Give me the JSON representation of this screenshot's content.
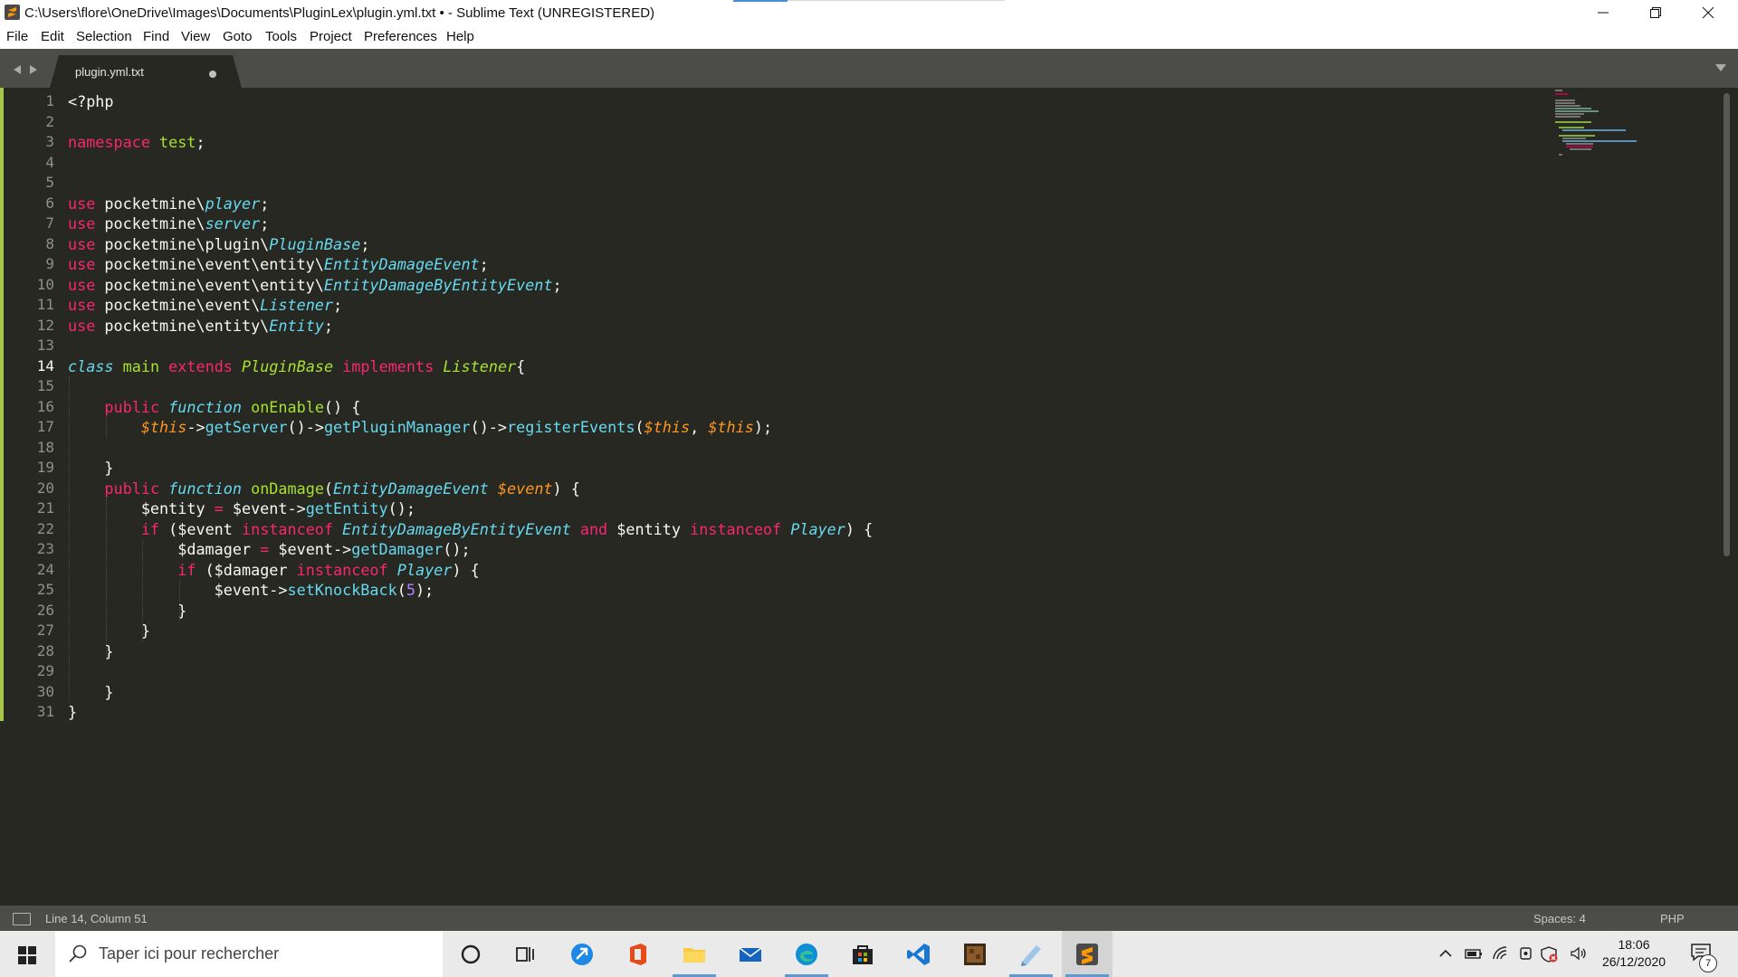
{
  "window": {
    "title": "C:\\Users\\flore\\OneDrive\\Images\\Documents\\PluginLex\\plugin.yml.txt • - Sublime Text (UNREGISTERED)"
  },
  "menu": [
    "File",
    "Edit",
    "Selection",
    "Find",
    "View",
    "Goto",
    "Tools",
    "Project",
    "Preferences",
    "Help"
  ],
  "tab": {
    "label": "plugin.yml.txt",
    "modified": true
  },
  "editor": {
    "active_line": 14,
    "lines": [
      [
        [
          "punc",
          "<?php"
        ]
      ],
      [],
      [
        [
          "k",
          "namespace"
        ],
        [
          "punc",
          " "
        ],
        [
          "cls",
          "test"
        ],
        [
          "punc",
          ";"
        ]
      ],
      [],
      [],
      [
        [
          "k",
          "use"
        ],
        [
          "punc",
          " pocketmine\\"
        ],
        [
          "s",
          "player"
        ],
        [
          "punc",
          ";"
        ]
      ],
      [
        [
          "k",
          "use"
        ],
        [
          "punc",
          " pocketmine\\"
        ],
        [
          "s",
          "server"
        ],
        [
          "punc",
          ";"
        ]
      ],
      [
        [
          "k",
          "use"
        ],
        [
          "punc",
          " pocketmine\\plugin\\"
        ],
        [
          "s",
          "PluginBase"
        ],
        [
          "punc",
          ";"
        ]
      ],
      [
        [
          "k",
          "use"
        ],
        [
          "punc",
          " pocketmine\\event\\entity\\"
        ],
        [
          "s",
          "EntityDamageEvent"
        ],
        [
          "punc",
          ";"
        ]
      ],
      [
        [
          "k",
          "use"
        ],
        [
          "punc",
          " pocketmine\\event\\entity\\"
        ],
        [
          "s",
          "EntityDamageByEntityEvent"
        ],
        [
          "punc",
          ";"
        ]
      ],
      [
        [
          "k",
          "use"
        ],
        [
          "punc",
          " pocketmine\\event\\"
        ],
        [
          "s",
          "Listener"
        ],
        [
          "punc",
          ";"
        ]
      ],
      [
        [
          "k",
          "use"
        ],
        [
          "punc",
          " pocketmine\\entity\\"
        ],
        [
          "s",
          "Entity"
        ],
        [
          "punc",
          ";"
        ]
      ],
      [],
      [
        [
          "s",
          "class"
        ],
        [
          "punc",
          " "
        ],
        [
          "cls",
          "main"
        ],
        [
          "punc",
          " "
        ],
        [
          "k",
          "extends"
        ],
        [
          "punc",
          " "
        ],
        [
          "ci",
          "PluginBase"
        ],
        [
          "punc",
          " "
        ],
        [
          "k",
          "implements"
        ],
        [
          "punc",
          " "
        ],
        [
          "ci",
          "Listener"
        ],
        [
          "punc",
          "{"
        ]
      ],
      [],
      [
        [
          "punc",
          "    "
        ],
        [
          "k",
          "public"
        ],
        [
          "punc",
          " "
        ],
        [
          "s",
          "function"
        ],
        [
          "punc",
          " "
        ],
        [
          "fd",
          "onEnable"
        ],
        [
          "punc",
          "() {"
        ]
      ],
      [
        [
          "punc",
          "        "
        ],
        [
          "v",
          "$this"
        ],
        [
          "punc",
          "->"
        ],
        [
          "fn",
          "getServer"
        ],
        [
          "punc",
          "()->"
        ],
        [
          "fn",
          "getPluginManager"
        ],
        [
          "punc",
          "()->"
        ],
        [
          "fn",
          "registerEvents"
        ],
        [
          "punc",
          "("
        ],
        [
          "v",
          "$this"
        ],
        [
          "punc",
          ", "
        ],
        [
          "v",
          "$this"
        ],
        [
          "punc",
          ");"
        ]
      ],
      [],
      [
        [
          "punc",
          "    }"
        ]
      ],
      [
        [
          "punc",
          "    "
        ],
        [
          "k",
          "public"
        ],
        [
          "punc",
          " "
        ],
        [
          "s",
          "function"
        ],
        [
          "punc",
          " "
        ],
        [
          "fd",
          "onDamage"
        ],
        [
          "punc",
          "("
        ],
        [
          "s",
          "EntityDamageEvent"
        ],
        [
          "punc",
          " "
        ],
        [
          "v",
          "$event"
        ],
        [
          "punc",
          ") {"
        ]
      ],
      [
        [
          "punc",
          "        $entity "
        ],
        [
          "k",
          "="
        ],
        [
          "punc",
          " $event->"
        ],
        [
          "fn",
          "getEntity"
        ],
        [
          "punc",
          "();"
        ]
      ],
      [
        [
          "punc",
          "        "
        ],
        [
          "k",
          "if"
        ],
        [
          "punc",
          " ($event "
        ],
        [
          "k",
          "instanceof"
        ],
        [
          "punc",
          " "
        ],
        [
          "s",
          "EntityDamageByEntityEvent"
        ],
        [
          "punc",
          " "
        ],
        [
          "k",
          "and"
        ],
        [
          "punc",
          " $entity "
        ],
        [
          "k",
          "instanceof"
        ],
        [
          "punc",
          " "
        ],
        [
          "s",
          "Player"
        ],
        [
          "punc",
          ") {"
        ]
      ],
      [
        [
          "punc",
          "            $damager "
        ],
        [
          "k",
          "="
        ],
        [
          "punc",
          " $event->"
        ],
        [
          "fn",
          "getDamager"
        ],
        [
          "punc",
          "();"
        ]
      ],
      [
        [
          "punc",
          "            "
        ],
        [
          "k",
          "if"
        ],
        [
          "punc",
          " ($damager "
        ],
        [
          "k",
          "instanceof"
        ],
        [
          "punc",
          " "
        ],
        [
          "s",
          "Player"
        ],
        [
          "punc",
          ") {"
        ]
      ],
      [
        [
          "punc",
          "                $event->"
        ],
        [
          "fn",
          "setKnockBack"
        ],
        [
          "punc",
          "("
        ],
        [
          "num",
          "5"
        ],
        [
          "punc",
          ");"
        ]
      ],
      [
        [
          "punc",
          "            }"
        ]
      ],
      [
        [
          "punc",
          "        }"
        ]
      ],
      [
        [
          "punc",
          "    }"
        ]
      ],
      [],
      [
        [
          "punc",
          "    }"
        ]
      ],
      [
        [
          "punc",
          "}"
        ]
      ]
    ]
  },
  "status": {
    "position": "Line 14, Column 51",
    "indent": "Spaces: 4",
    "syntax": "PHP"
  },
  "taskbar": {
    "search_placeholder": "Taper ici pour rechercher",
    "time": "18:06",
    "date": "26/12/2020",
    "notification_count": "7"
  },
  "colors": {
    "editor_bg": "#272822",
    "keyword": "#f92672",
    "storage": "#66d9ef",
    "class_name": "#a6e22e",
    "variable_param": "#fd971f",
    "number": "#ae81ff",
    "text": "#f8f8f2"
  }
}
